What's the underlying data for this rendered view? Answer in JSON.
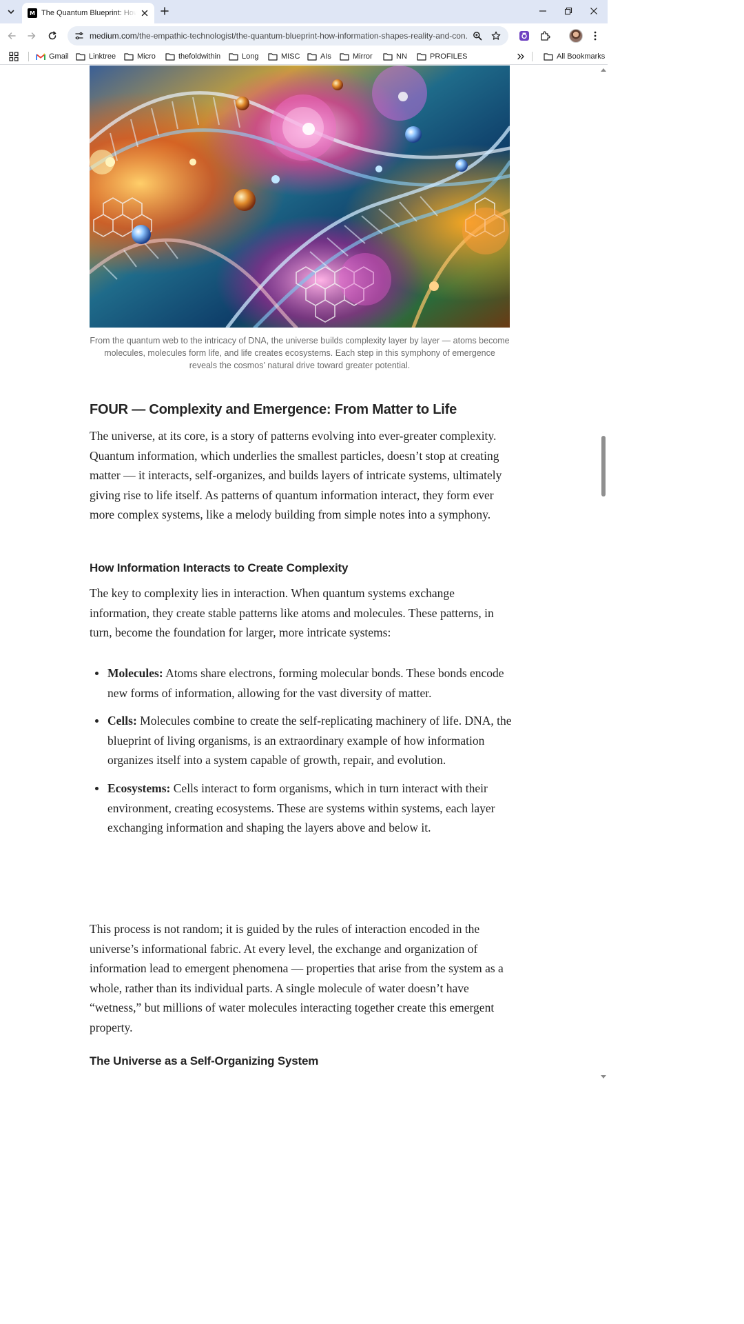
{
  "browser": {
    "tab_title": "The Quantum Blueprint: How Information Shapes Reality",
    "favicon_text": "M",
    "url_domain": "medium.com",
    "url_path": "/the-empathic-technologist/the-quantum-blueprint-how-information-shapes-reality-and-con..."
  },
  "bookmarks": {
    "items": [
      "Gmail",
      "Linktree",
      "Micro",
      "thefoldwithin",
      "Long",
      "MISC",
      "AIs",
      "Mirror",
      "NN",
      "PROFILES"
    ],
    "all_bookmarks": "All Bookmarks"
  },
  "article": {
    "image_caption": "From the quantum web to the intricacy of DNA, the universe builds complexity layer by layer — atoms become molecules, molecules form life, and life creates ecosystems. Each step in this symphony of emergence reveals the cosmos’ natural drive toward greater potential.",
    "section_heading": "FOUR — Complexity and Emergence: From Matter to Life",
    "intro_paragraph": "The universe, at its core, is a story of patterns evolving into ever-greater complexity. Quantum information, which underlies the smallest particles, doesn’t stop at creating matter — it interacts, self-organizes, and builds layers of intricate systems, ultimately giving rise to life itself. As patterns of quantum information interact, they form ever more complex systems, like a melody building from simple notes into a symphony.",
    "subheading_1": "How Information Interacts to Create Complexity",
    "paragraph_2": "The key to complexity lies in interaction. When quantum systems exchange information, they create stable patterns like atoms and molecules. These patterns, in turn, become the foundation for larger, more intricate systems:",
    "list": [
      {
        "term": "Molecules:",
        "text": " Atoms share electrons, forming molecular bonds. These bonds encode new forms of information, allowing for the vast diversity of matter."
      },
      {
        "term": "Cells:",
        "text": " Molecules combine to create the self-replicating machinery of life. DNA, the blueprint of living organisms, is an extraordinary example of how information organizes itself into a system capable of growth, repair, and evolution."
      },
      {
        "term": "Ecosystems:",
        "text": " Cells interact to form organisms, which in turn interact with their environment, creating ecosystems. These are systems within systems, each layer exchanging information and shaping the layers above and below it."
      }
    ],
    "paragraph_3": "This process is not random; it is guided by the rules of interaction encoded in the universe’s informational fabric. At every level, the exchange and organization of information lead to emergent phenomena — properties that arise from the system as a whole, rather than its individual parts. A single molecule of water doesn’t have “wetness,” but millions of water molecules interacting together create this emergent property.",
    "subheading_2": "The Universe as a Self-Organizing System"
  }
}
